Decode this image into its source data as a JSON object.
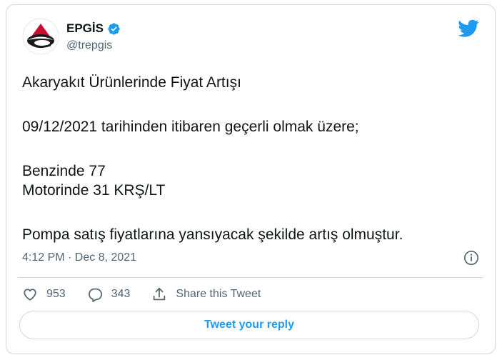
{
  "author": {
    "display_name": "EPGİS",
    "handle": "@trepgis",
    "verified_icon": "verified-badge-icon",
    "avatar_icon": "epgis-logo-icon"
  },
  "tweet": {
    "lines": {
      "title": "Akaryakıt Ürünlerinde Fiyat Artışı",
      "date_line": "09/12/2021 tarihinden itibaren geçerli olmak üzere;",
      "benzin": "Benzinde 77",
      "motorin": "Motorinde 31 KRŞ/LT",
      "closing": "Pompa satış fiyatlarına yansıyacak şekilde artış olmuştur."
    },
    "timestamp": "4:12 PM · Dec 8, 2021"
  },
  "actions": {
    "like_count": "953",
    "reply_count": "343",
    "share_label": "Share this Tweet"
  },
  "reply_button": {
    "label": "Tweet your reply"
  },
  "colors": {
    "accent": "#1d9bf0",
    "text": "#0f1419",
    "secondary": "#536471",
    "border": "#cfd9de",
    "logo_red": "#c8102e"
  }
}
